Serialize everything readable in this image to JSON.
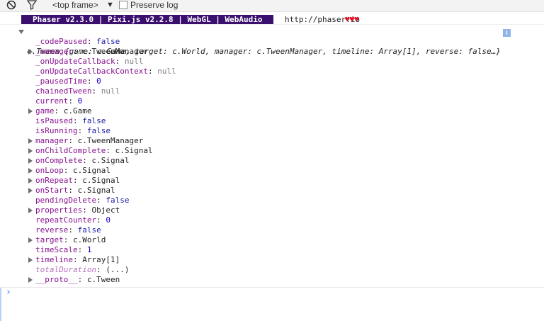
{
  "toolbar": {
    "frame_select": "<top frame>",
    "preserve_log": "Preserve log"
  },
  "banner": {
    "text": "Phaser v2.3.0 | Pixi.js v2.2.8 | WebGL | WebAudio",
    "url": "http://phaser.io",
    "hearts": "♥♥♥"
  },
  "object": {
    "summary": "c.Tween {game: c.Game, target: c.World, manager: c.TweenManager, timeline: Array[1], reverse: false…}",
    "info_badge": "i",
    "properties": [
      {
        "key": "_codePaused",
        "sep": ": ",
        "value": "false",
        "type": "bool",
        "expandable": false
      },
      {
        "key": "_manager",
        "sep": ": ",
        "value": "c.TweenManager",
        "type": "obj",
        "expandable": true
      },
      {
        "key": "_onUpdateCallback",
        "sep": ": ",
        "value": "null",
        "type": "null",
        "expandable": false
      },
      {
        "key": "_onUpdateCallbackContext",
        "sep": ": ",
        "value": "null",
        "type": "null",
        "expandable": false
      },
      {
        "key": "_pausedTime",
        "sep": ": ",
        "value": "0",
        "type": "num",
        "expandable": false
      },
      {
        "key": "chainedTween",
        "sep": ": ",
        "value": "null",
        "type": "null",
        "expandable": false
      },
      {
        "key": "current",
        "sep": ": ",
        "value": "0",
        "type": "num",
        "expandable": false
      },
      {
        "key": "game",
        "sep": ": ",
        "value": "c.Game",
        "type": "obj",
        "expandable": true
      },
      {
        "key": "isPaused",
        "sep": ": ",
        "value": "false",
        "type": "bool",
        "expandable": false
      },
      {
        "key": "isRunning",
        "sep": ": ",
        "value": "false",
        "type": "bool",
        "expandable": false
      },
      {
        "key": "manager",
        "sep": ": ",
        "value": "c.TweenManager",
        "type": "obj",
        "expandable": true
      },
      {
        "key": "onChildComplete",
        "sep": ": ",
        "value": "c.Signal",
        "type": "obj",
        "expandable": true
      },
      {
        "key": "onComplete",
        "sep": ": ",
        "value": "c.Signal",
        "type": "obj",
        "expandable": true
      },
      {
        "key": "onLoop",
        "sep": ": ",
        "value": "c.Signal",
        "type": "obj",
        "expandable": true
      },
      {
        "key": "onRepeat",
        "sep": ": ",
        "value": "c.Signal",
        "type": "obj",
        "expandable": true
      },
      {
        "key": "onStart",
        "sep": ": ",
        "value": "c.Signal",
        "type": "obj",
        "expandable": true
      },
      {
        "key": "pendingDelete",
        "sep": ": ",
        "value": "false",
        "type": "bool",
        "expandable": false
      },
      {
        "key": "properties",
        "sep": ": ",
        "value": "Object",
        "type": "obj",
        "expandable": true
      },
      {
        "key": "repeatCounter",
        "sep": ": ",
        "value": "0",
        "type": "num",
        "expandable": false
      },
      {
        "key": "reverse",
        "sep": ": ",
        "value": "false",
        "type": "bool",
        "expandable": false
      },
      {
        "key": "target",
        "sep": ": ",
        "value": "c.World",
        "type": "obj",
        "expandable": true
      },
      {
        "key": "timeScale",
        "sep": ": ",
        "value": "1",
        "type": "num",
        "expandable": false
      },
      {
        "key": "timeline",
        "sep": ": ",
        "value": "Array[1]",
        "type": "obj",
        "expandable": true
      },
      {
        "key": "totalDuration",
        "sep": ": ",
        "value": "(...)",
        "type": "getter",
        "expandable": false
      },
      {
        "key": "__proto__",
        "sep": ": ",
        "value": "c.Tween",
        "type": "obj",
        "expandable": true
      }
    ]
  },
  "console": {
    "prompt": "›"
  }
}
